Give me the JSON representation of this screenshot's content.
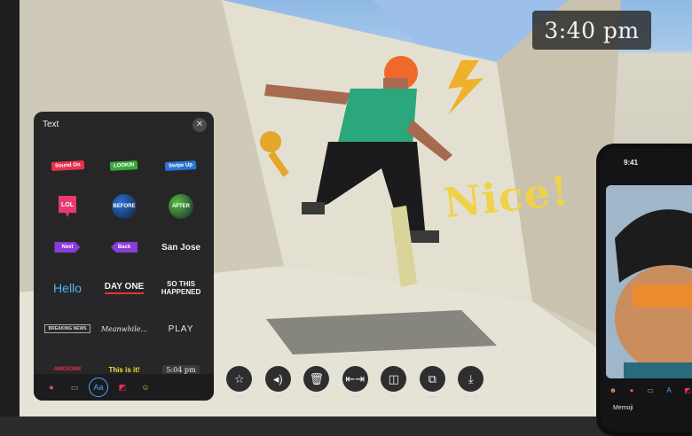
{
  "overlay": {
    "time_text": "3:40 pm",
    "nice_text": "Nice!"
  },
  "panel": {
    "title": "Text",
    "close_glyph": "✕",
    "stickers": [
      {
        "name": "sticker-sound-on",
        "text": "Sound On",
        "style": "tag",
        "color": "#e8334f"
      },
      {
        "name": "sticker-lookin",
        "text": "LOOKIN",
        "style": "tag",
        "color": "#3aa83a"
      },
      {
        "name": "sticker-swipe-up",
        "text": "Swipe Up",
        "style": "tag",
        "color": "#2b74d6"
      },
      {
        "name": "sticker-lol",
        "text": "LOL",
        "style": "lol",
        "color": "#e83a6e"
      },
      {
        "name": "sticker-before",
        "text": "BEFORE",
        "style": "circle",
        "color": "#2a6fd8"
      },
      {
        "name": "sticker-after",
        "text": "AFTER",
        "style": "circle",
        "color": "#5bbd3e"
      },
      {
        "name": "sticker-next",
        "text": "Next",
        "style": "arrow-right",
        "color": "#8a3bd8"
      },
      {
        "name": "sticker-back",
        "text": "Back",
        "style": "arrow-left",
        "color": "#8a3bd8"
      },
      {
        "name": "sticker-san-jose",
        "text": "San Jose",
        "style": "plain",
        "color": "#f2f2f2"
      },
      {
        "name": "sticker-hello",
        "text": "Hello",
        "style": "hello",
        "color": "#4fb3f0"
      },
      {
        "name": "sticker-day-one",
        "text": "DAY ONE",
        "style": "dayone",
        "color": "#f2f2f2"
      },
      {
        "name": "sticker-so-this-happened",
        "text": "SO THIS HAPPENED",
        "style": "happened",
        "color": "#f2f2f2"
      },
      {
        "name": "sticker-breaking-news",
        "text": "BREAKING NEWS",
        "style": "news",
        "color": "#dddddd"
      },
      {
        "name": "sticker-meanwhile",
        "text": "Meanwhile...",
        "style": "meanwhile",
        "color": "#e6e6e6"
      },
      {
        "name": "sticker-play",
        "text": "PLAY",
        "style": "play",
        "color": "#e8e8e8"
      },
      {
        "name": "sticker-awesome",
        "text": "AWESOME",
        "style": "awesome",
        "color": "#e2334b"
      },
      {
        "name": "sticker-this-is-it",
        "text": "This is it!",
        "style": "isit",
        "color": "#f2e13a"
      },
      {
        "name": "sticker-clock",
        "text": "5:04 pm",
        "style": "clock",
        "color": "#eeeeee"
      }
    ],
    "tabs": [
      {
        "name": "tab-filters",
        "icon": "color-filters-icon",
        "glyph": "●",
        "selected": false
      },
      {
        "name": "tab-titles",
        "icon": "speech-bubble-icon",
        "glyph": "▭",
        "selected": false
      },
      {
        "name": "tab-text",
        "icon": "text-aa-icon",
        "glyph": "Aa",
        "selected": true
      },
      {
        "name": "tab-stickers",
        "icon": "sticker-icon",
        "glyph": "◩",
        "selected": false
      },
      {
        "name": "tab-emoji",
        "icon": "emoji-icon",
        "glyph": "☺",
        "selected": false
      }
    ]
  },
  "toolbar": {
    "tools": [
      {
        "name": "effects-button",
        "icon": "star-icon",
        "glyph": "☆",
        "label": "Effects"
      },
      {
        "name": "mute-button",
        "icon": "speaker-icon",
        "glyph": "◂)",
        "label": "Mute"
      },
      {
        "name": "delete-button",
        "icon": "trash-icon",
        "glyph": "🗑",
        "label": "Delete"
      },
      {
        "name": "trim-button",
        "icon": "trim-icon",
        "glyph": "⇤⇥",
        "label": "Trim"
      },
      {
        "name": "split-button",
        "icon": "split-icon",
        "glyph": "◫",
        "label": "Split"
      },
      {
        "name": "duplicate-button",
        "icon": "duplicate-icon",
        "glyph": "⧉",
        "label": "Duplicate"
      },
      {
        "name": "save-clip-button",
        "icon": "download-icon",
        "glyph": "⤓",
        "label": "Save Clip"
      }
    ]
  },
  "phone": {
    "status_time": "9:41",
    "mode_label": "Memoji",
    "tools": [
      {
        "name": "phone-memoji-tab",
        "icon": "memoji-icon",
        "glyph": "☻"
      },
      {
        "name": "phone-filters-tab",
        "icon": "color-filters-icon",
        "glyph": "●"
      },
      {
        "name": "phone-titles-tab",
        "icon": "speech-bubble-icon",
        "glyph": "▭"
      },
      {
        "name": "phone-text-tab",
        "icon": "text-aa-icon",
        "glyph": "A"
      },
      {
        "name": "phone-stickers-tab",
        "icon": "sticker-icon",
        "glyph": "◩"
      }
    ]
  },
  "colors": {
    "accent": "#4aa8ff",
    "panel_bg": "#202022",
    "nice_yellow": "#f0d24a"
  }
}
